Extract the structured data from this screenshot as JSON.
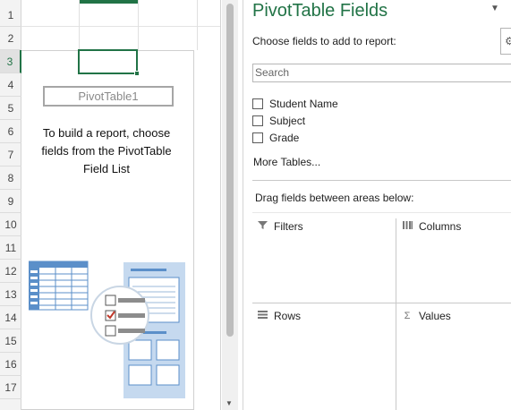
{
  "sheet": {
    "row_numbers": [
      "1",
      "2",
      "3",
      "4",
      "5",
      "6",
      "7",
      "8",
      "9",
      "10",
      "11",
      "12",
      "13",
      "14",
      "15",
      "16",
      "17"
    ],
    "active_row": "3",
    "pivot_title": "PivotTable1",
    "instructions": "To build a report, choose fields from the PivotTable Field List"
  },
  "pane": {
    "title": "PivotTable Fields",
    "choose_label": "Choose fields to add to report:",
    "search_placeholder": "Search",
    "fields": [
      {
        "label": "Student Name",
        "checked": false
      },
      {
        "label": "Subject",
        "checked": false
      },
      {
        "label": "Grade",
        "checked": false
      }
    ],
    "more_tables": "More Tables...",
    "drag_label": "Drag fields between areas below:",
    "areas": {
      "filters": "Filters",
      "columns": "Columns",
      "rows": "Rows",
      "values": "Values"
    }
  },
  "icons": {
    "filter": "filter-icon",
    "columns": "columns-icon",
    "rows": "rows-icon",
    "values": "sigma-icon",
    "pane_options": "chevron-down-icon",
    "settings": "gear-icon"
  },
  "colors": {
    "accent": "#217346",
    "illustration_blue": "#5b8fc9",
    "illustration_light": "#c5d9ef",
    "check_red": "#c0392b"
  }
}
